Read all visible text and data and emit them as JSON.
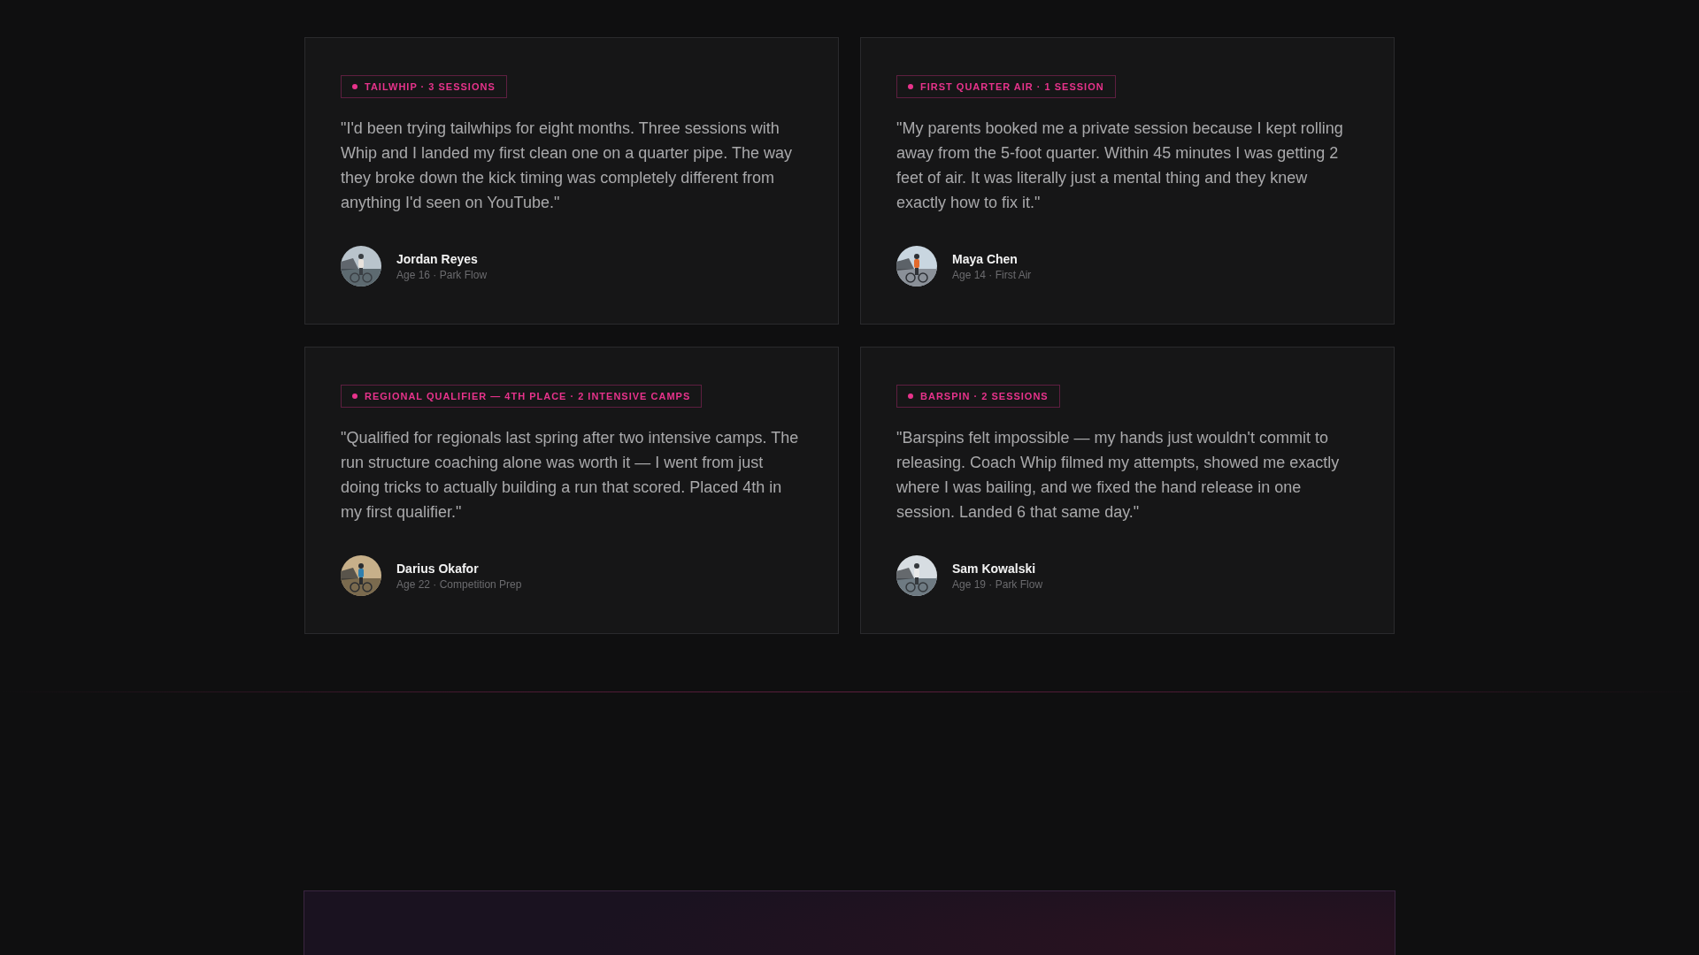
{
  "testimonials": [
    {
      "tag": "TAILWHIP · 3 SESSIONS",
      "quote": "\"I'd been trying tailwhips for eight months. Three sessions with Whip and I landed my first clean one on a quarter pipe. The way they broke down the kick timing was completely different from anything I'd seen on YouTube.\"",
      "name": "Jordan Reyes",
      "meta": "Age 16 · Park Flow"
    },
    {
      "tag": "FIRST QUARTER AIR · 1 SESSION",
      "quote": "\"My parents booked me a private session because I kept rolling away from the 5-foot quarter. Within 45 minutes I was getting 2 feet of air. It was literally just a mental thing and they knew exactly how to fix it.\"",
      "name": "Maya Chen",
      "meta": "Age 14 · First Air"
    },
    {
      "tag": "REGIONAL QUALIFIER — 4TH PLACE · 2 INTENSIVE CAMPS",
      "quote": "\"Qualified for regionals last spring after two intensive camps. The run structure coaching alone was worth it — I went from just doing tricks to actually building a run that scored. Placed 4th in my first qualifier.\"",
      "name": "Darius Okafor",
      "meta": "Age 22 · Competition Prep"
    },
    {
      "tag": "BARSPIN · 2 SESSIONS",
      "quote": "\"Barspins felt impossible — my hands just wouldn't commit to releasing. Coach Whip filmed my attempts, showed me exactly where I was bailing, and we fixed the hand release in one session. Landed 6 that same day.\"",
      "name": "Sam Kowalski",
      "meta": "Age 19 · Park Flow"
    }
  ]
}
